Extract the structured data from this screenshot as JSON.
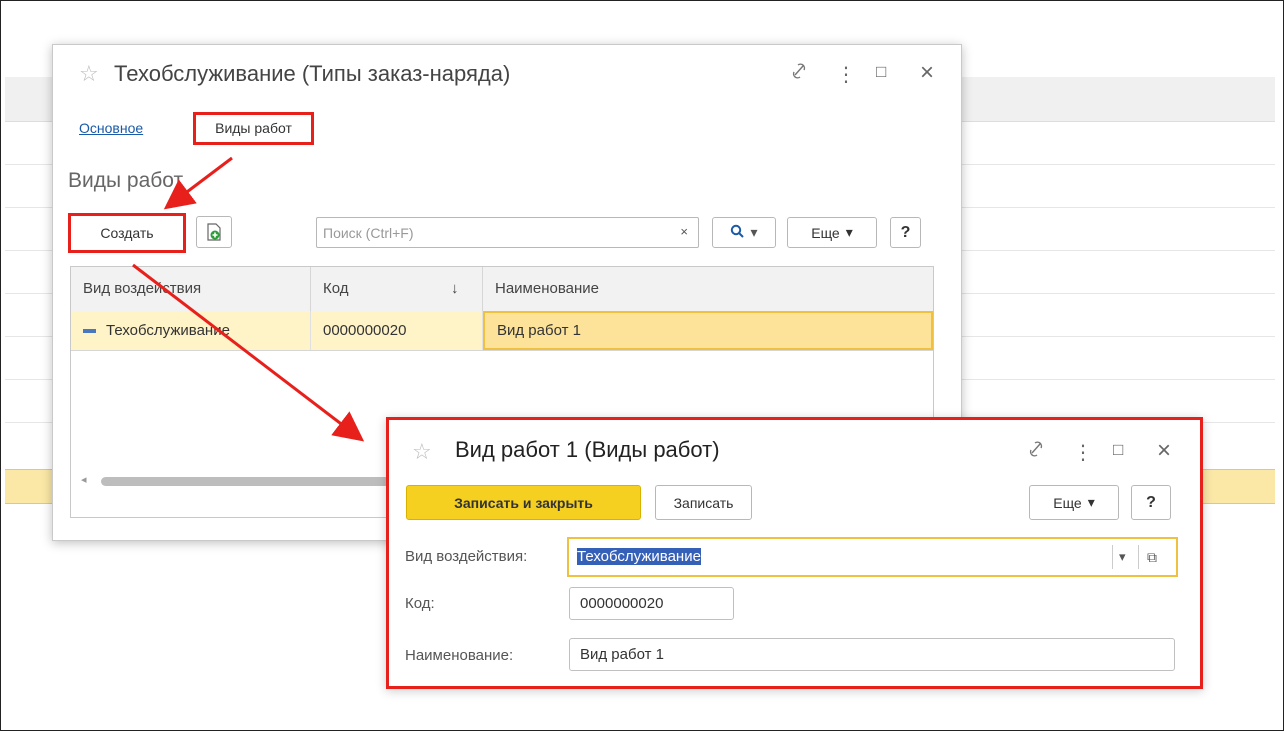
{
  "window1": {
    "title": "Техобслуживание (Типы заказ-наряда)",
    "tabs": [
      "Основное",
      "Виды работ"
    ],
    "section_title": "Виды работ",
    "toolbar": {
      "create_label": "Создать",
      "search_placeholder": "Поиск (Ctrl+F)",
      "clear_symbol": "×",
      "search_symbol": "Q",
      "more_label": "Еще",
      "help_label": "?"
    },
    "table": {
      "columns": [
        "Вид воздействия",
        "Код",
        "Наименование"
      ],
      "sort_indicator": "↓",
      "rows": [
        {
          "type": "Техобслуживание",
          "code": "0000000020",
          "name": "Вид работ 1"
        }
      ]
    }
  },
  "window2": {
    "title": "Вид работ 1 (Виды работ)",
    "save_close_label": "Записать и закрыть",
    "save_label": "Записать",
    "more_label": "Еще",
    "help_label": "?",
    "fields": {
      "type_label": "Вид воздействия:",
      "type_value": "Техобслуживание",
      "code_label": "Код:",
      "code_value": "0000000020",
      "name_label": "Наименование:",
      "name_value": "Вид работ 1"
    }
  },
  "icons": {
    "star": "☆",
    "link": "🔗",
    "menu": "⋮",
    "maximize": "□",
    "close": "×",
    "dropdown": "▾",
    "open": "⧉"
  },
  "colors": {
    "annotation_red": "#e8201c",
    "primary_yellow": "#f5d021",
    "row_highlight": "#fde39a",
    "link_blue": "#1a5aa8"
  }
}
